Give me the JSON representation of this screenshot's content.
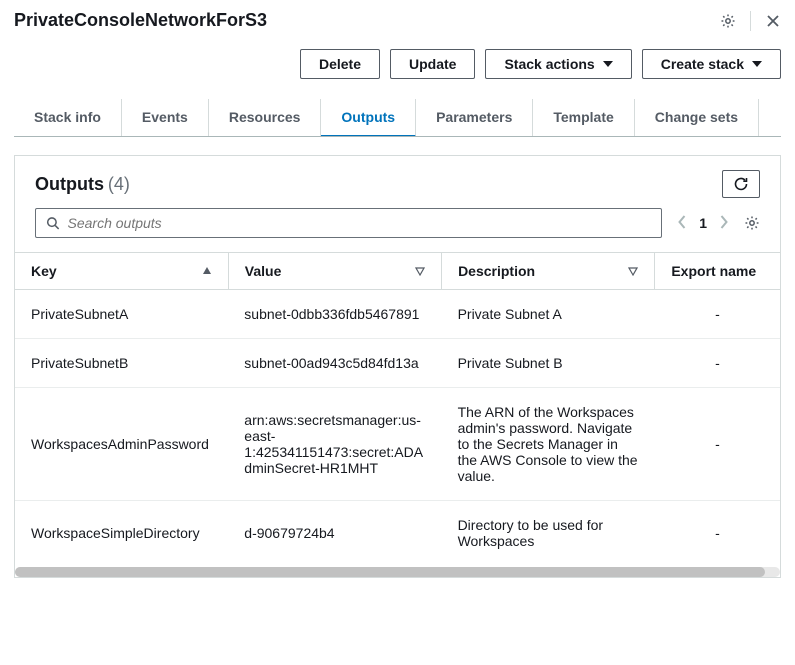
{
  "header": {
    "title": "PrivateConsoleNetworkForS3"
  },
  "actions": {
    "delete": "Delete",
    "update": "Update",
    "stack_actions": "Stack actions",
    "create_stack": "Create stack"
  },
  "tabs": [
    {
      "label": "Stack info",
      "active": false
    },
    {
      "label": "Events",
      "active": false
    },
    {
      "label": "Resources",
      "active": false
    },
    {
      "label": "Outputs",
      "active": true
    },
    {
      "label": "Parameters",
      "active": false
    },
    {
      "label": "Template",
      "active": false
    },
    {
      "label": "Change sets",
      "active": false
    }
  ],
  "panel": {
    "title": "Outputs",
    "count_display": "(4)",
    "search_placeholder": "Search outputs",
    "page_current": "1"
  },
  "columns": {
    "key": "Key",
    "value": "Value",
    "description": "Description",
    "export_name": "Export name"
  },
  "rows": [
    {
      "key": "PrivateSubnetA",
      "value": "subnet-0dbb336fdb5467891",
      "description": "Private Subnet A",
      "export_name": "-"
    },
    {
      "key": "PrivateSubnetB",
      "value": "subnet-00ad943c5d84fd13a",
      "description": "Private Subnet B",
      "export_name": "-"
    },
    {
      "key": "WorkspacesAdminPassword",
      "value": "arn:aws:secretsmanager:us-east-1:425341151473:secret:ADAdminSecret-HR1MHT",
      "description": "The ARN of the Workspaces admin's password. Navigate to the Secrets Manager in the AWS Console to view the value.",
      "export_name": "-"
    },
    {
      "key": "WorkspaceSimpleDirectory",
      "value": "d-90679724b4",
      "description": "Directory to be used for Workspaces",
      "export_name": "-"
    }
  ]
}
